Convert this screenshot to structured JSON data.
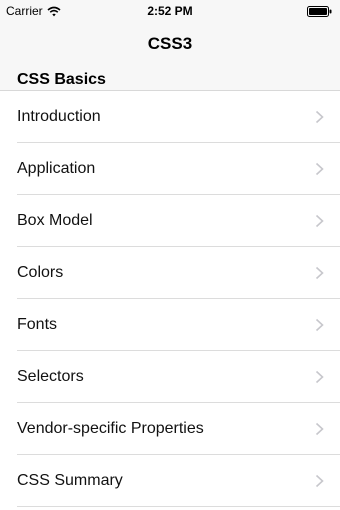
{
  "status_bar": {
    "carrier": "Carrier",
    "time": "2:52 PM",
    "icons": [
      "wifi-icon",
      "battery-icon"
    ]
  },
  "nav_bar": {
    "title": "CSS3"
  },
  "section": {
    "header": "CSS Basics",
    "items": [
      {
        "label": "Introduction"
      },
      {
        "label": "Application"
      },
      {
        "label": "Box Model"
      },
      {
        "label": "Colors"
      },
      {
        "label": "Fonts"
      },
      {
        "label": "Selectors"
      },
      {
        "label": "Vendor-specific Properties"
      },
      {
        "label": "CSS Summary"
      }
    ]
  },
  "colors": {
    "bar_background": "#f7f7f7",
    "separator": "#dcdcdc",
    "chevron": "#c7c7cc"
  }
}
